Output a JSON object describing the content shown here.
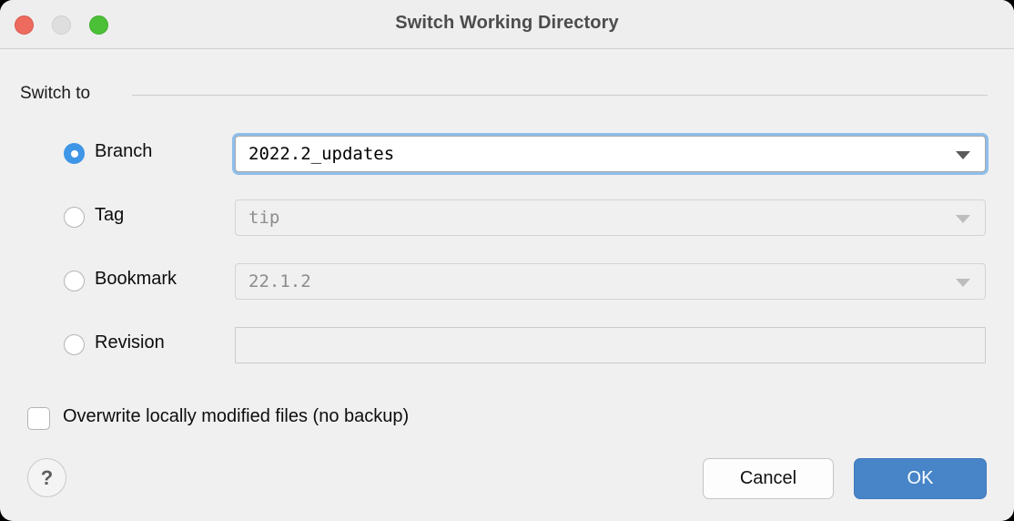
{
  "window": {
    "title": "Switch Working Directory",
    "traffic_lights": [
      {
        "name": "close",
        "color": "#ed6a5e"
      },
      {
        "name": "minimize",
        "color": "#dedede"
      },
      {
        "name": "maximize",
        "color": "#4cc137"
      }
    ]
  },
  "group": {
    "label": "Switch to"
  },
  "options": [
    {
      "id": "branch",
      "label": "Branch",
      "selected": true,
      "control": "combobox",
      "value": "2022.2_updates",
      "enabled": true
    },
    {
      "id": "tag",
      "label": "Tag",
      "selected": false,
      "control": "combobox",
      "value": "tip",
      "enabled": false
    },
    {
      "id": "bookmark",
      "label": "Bookmark",
      "selected": false,
      "control": "combobox",
      "value": "22.1.2",
      "enabled": false
    },
    {
      "id": "revision",
      "label": "Revision",
      "selected": false,
      "control": "textfield",
      "value": "",
      "enabled": false
    }
  ],
  "checkbox": {
    "label": "Overwrite locally modified files (no backup)",
    "checked": false
  },
  "footer": {
    "help_label": "?",
    "cancel_label": "Cancel",
    "ok_label": "OK",
    "ok_color": "#4785c8"
  }
}
